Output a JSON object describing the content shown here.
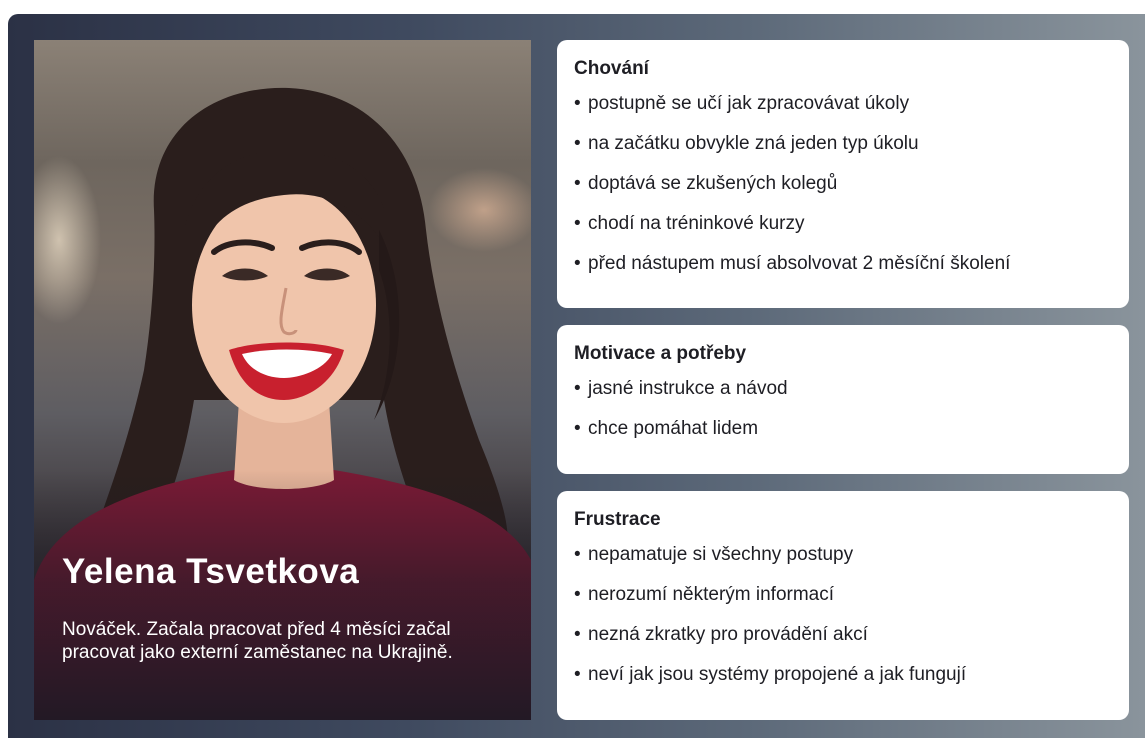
{
  "persona": {
    "name": "Yelena Tsvetkova",
    "description": "Nováček. Začala pracovat před 4 měsíci začal pracovat jako externí zaměstanec na Ukrajině."
  },
  "cards": [
    {
      "title": "Chování",
      "items": [
        "postupně se učí jak zpracovávat úkoly",
        "na začátku obvykle zná jeden typ úkolu",
        "doptává se zkušených kolegů",
        "chodí na tréninkové kurzy",
        "před nástupem musí absolvovat 2 měsíční školení"
      ]
    },
    {
      "title": "Motivace a potřeby",
      "items": [
        "jasné instrukce a návod",
        "chce pomáhat lidem"
      ]
    },
    {
      "title": "Frustrace",
      "items": [
        "nepamatuje si všechny postupy",
        "nerozumí některým informací",
        "nezná zkratky pro provádění akcí",
        "neví jak jsou systémy propojené a jak fungují"
      ]
    }
  ],
  "colors": {
    "text": "#1e1e24",
    "card_bg": "#ffffff",
    "frame_left": "#2b3145",
    "frame_right": "#8a949c",
    "sweater": "#7a1a35",
    "lips": "#c8202e"
  },
  "bullet_char": "•"
}
